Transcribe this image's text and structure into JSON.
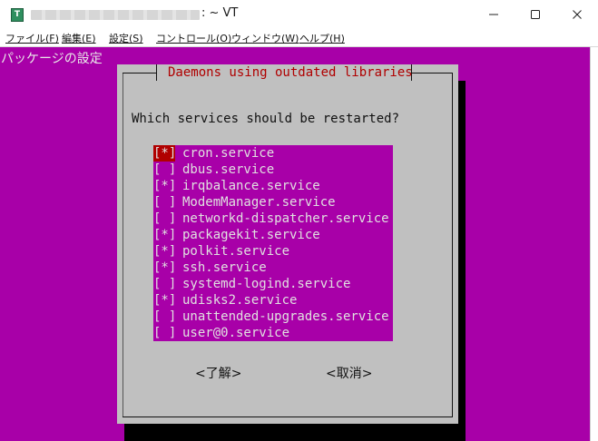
{
  "window": {
    "title_suffix": ": ~ VT",
    "app_icon": "T",
    "controls": [
      "minimize-icon",
      "maximize-icon",
      "close-icon"
    ]
  },
  "menu": {
    "file": "ファイル(F)",
    "edit": "編集(E)",
    "settings": "設定(S)",
    "control": "コントロール(O)",
    "window": "ウィンドウ(W)",
    "help": "ヘルプ(H)"
  },
  "terminal": {
    "header": "パッケージの設定",
    "background_color": "#a800a8"
  },
  "dialog": {
    "title": "Daemons using outdated libraries",
    "question": "Which services should be restarted?",
    "services": [
      {
        "check": "[*]",
        "name": "cron.service",
        "cursor": true
      },
      {
        "check": "[ ]",
        "name": "dbus.service"
      },
      {
        "check": "[*]",
        "name": "irqbalance.service"
      },
      {
        "check": "[ ]",
        "name": "ModemManager.service"
      },
      {
        "check": "[ ]",
        "name": "networkd-dispatcher.service"
      },
      {
        "check": "[*]",
        "name": "packagekit.service"
      },
      {
        "check": "[*]",
        "name": "polkit.service"
      },
      {
        "check": "[*]",
        "name": "ssh.service"
      },
      {
        "check": "[ ]",
        "name": "systemd-logind.service"
      },
      {
        "check": "[*]",
        "name": "udisks2.service"
      },
      {
        "check": "[ ]",
        "name": "unattended-upgrades.service"
      },
      {
        "check": "[ ]",
        "name": "user@0.service"
      }
    ],
    "ok_button": "<了解>",
    "cancel_button": "<取消>"
  }
}
